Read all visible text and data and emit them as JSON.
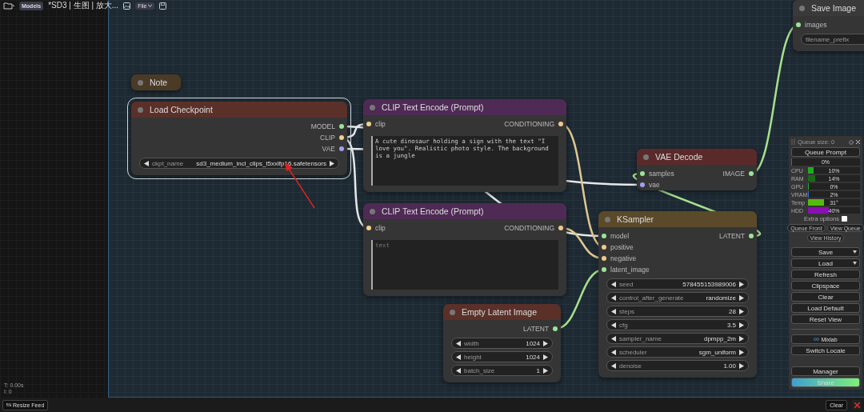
{
  "top_bar": {
    "models_label": "Models",
    "workflow_title": "*SD3 | 生图 | 放大...",
    "file_menu": "File"
  },
  "nodes": [
    {
      "title": "Note",
      "color": "#4a3a26",
      "selected": false
    },
    {
      "title": "Load Checkpoint",
      "color": "#5a3029",
      "selected": true,
      "outputs": [
        {
          "name": "MODEL",
          "color": "#9be49b"
        },
        {
          "name": "CLIP",
          "color": "#f0d08c"
        },
        {
          "name": "VAE",
          "color": "#a0a0f0"
        }
      ],
      "widgets": [
        {
          "kind": "combo",
          "label": "ckpt_name",
          "value": "sd3_medium_incl_clips_t5xxlfp16.safetensors"
        }
      ]
    },
    {
      "title": "CLIP Text Encode (Prompt)",
      "color": "#4f2a55",
      "selected": false,
      "inputs": [
        {
          "name": "clip",
          "color": "#f0d08c"
        }
      ],
      "outputs": [
        {
          "name": "CONDITIONING",
          "color": "#f0c890"
        }
      ],
      "widgets": [
        {
          "kind": "textarea",
          "value": "A cute dinosaur holding a sign with the text \"I love you\". Realistic photo style. The background is a jungle"
        }
      ]
    },
    {
      "title": "CLIP Text Encode (Prompt)",
      "color": "#4f2a55",
      "selected": false,
      "inputs": [
        {
          "name": "clip",
          "color": "#f0d08c"
        }
      ],
      "outputs": [
        {
          "name": "CONDITIONING",
          "color": "#f0c890"
        }
      ],
      "widgets": [
        {
          "kind": "textarea",
          "placeholder": "text"
        }
      ]
    },
    {
      "title": "VAE Decode",
      "color": "#5a2a2a",
      "selected": false,
      "inputs": [
        {
          "name": "samples",
          "color": "#9be49b"
        },
        {
          "name": "vae",
          "color": "#a0a0f0"
        }
      ],
      "outputs": [
        {
          "name": "IMAGE",
          "color": "#9be49b"
        }
      ]
    },
    {
      "title": "KSampler",
      "color": "#5a4a2a",
      "selected": false,
      "inputs": [
        {
          "name": "model",
          "color": "#9be49b"
        },
        {
          "name": "positive",
          "color": "#f0c890"
        },
        {
          "name": "negative",
          "color": "#f0c890"
        },
        {
          "name": "latent_image",
          "color": "#9be49b"
        }
      ],
      "outputs": [
        {
          "name": "LATENT",
          "color": "#9be49b"
        }
      ],
      "widgets": [
        {
          "kind": "number",
          "label": "seed",
          "value": "578455153989006"
        },
        {
          "kind": "combo",
          "label": "control_after_generate",
          "value": "randomize"
        },
        {
          "kind": "number",
          "label": "steps",
          "value": "28"
        },
        {
          "kind": "number",
          "label": "cfg",
          "value": "3.5"
        },
        {
          "kind": "combo",
          "label": "sampler_name",
          "value": "dpmpp_2m"
        },
        {
          "kind": "combo",
          "label": "scheduler",
          "value": "sgm_uniform"
        },
        {
          "kind": "number",
          "label": "denoise",
          "value": "1.00"
        }
      ]
    },
    {
      "title": "Empty Latent Image",
      "color": "#5a3029",
      "selected": false,
      "outputs": [
        {
          "name": "LATENT",
          "color": "#9be49b"
        }
      ],
      "widgets": [
        {
          "kind": "number",
          "label": "width",
          "value": "1024"
        },
        {
          "kind": "number",
          "label": "height",
          "value": "1024"
        },
        {
          "kind": "number",
          "label": "batch_size",
          "value": "1"
        }
      ]
    },
    {
      "title": "Save Image",
      "color": "#3a3a3a",
      "selected": false,
      "inputs": [
        {
          "name": "images",
          "color": "#9be49b"
        }
      ],
      "widgets": [
        {
          "kind": "text",
          "label": "filename_prefix"
        }
      ]
    }
  ],
  "queue_panel": {
    "queue_size": "Queue size: 0",
    "queue_button": "Queue Prompt",
    "progress": {
      "text": "0%",
      "level": 0
    },
    "stats": [
      {
        "label": "CPU",
        "value": "10%",
        "level": 0.1,
        "color": "#22aa22"
      },
      {
        "label": "RAM",
        "value": "14%",
        "level": 0.14,
        "color": "#1a6a1a"
      },
      {
        "label": "GPU",
        "value": "0%",
        "level": 0,
        "color": "#22aa22"
      },
      {
        "label": "VRAM",
        "value": "2%",
        "level": 0.02,
        "color": "#3a6ad0"
      },
      {
        "label": "Temp",
        "value": "31°",
        "level": 0.31,
        "color": "#55bb11"
      },
      {
        "label": "HDD",
        "value": "40%",
        "level": 0.4,
        "color": "#8a10b0"
      }
    ],
    "extra_options": {
      "label": "Extra options",
      "checked": false
    },
    "small_buttons": [
      "Queue Front",
      "View Queue",
      "View History"
    ],
    "buttons": [
      {
        "label": "Save",
        "dropdown": true
      },
      {
        "label": "Load",
        "dropdown": true
      },
      {
        "label": "Refresh",
        "dropdown": false
      },
      {
        "label": "Clipspace",
        "dropdown": false
      },
      {
        "label": "Clear",
        "dropdown": false
      },
      {
        "label": "Load Default",
        "dropdown": false
      },
      {
        "label": "Reset View",
        "dropdown": false
      }
    ],
    "extension_buttons": [
      {
        "label": "Mixlab",
        "kind": "mixlab"
      },
      {
        "label": "Switch Locale",
        "kind": "plain"
      }
    ],
    "bottom_buttons": [
      {
        "label": "Manager",
        "kind": "plain"
      },
      {
        "label": "Share",
        "kind": "share"
      }
    ]
  },
  "stats_overlay": [
    "T: 0.00s",
    "I: 0"
  ],
  "bottom_bar": {
    "resize_button": "Resize Feed",
    "clear_button": "Clear"
  }
}
